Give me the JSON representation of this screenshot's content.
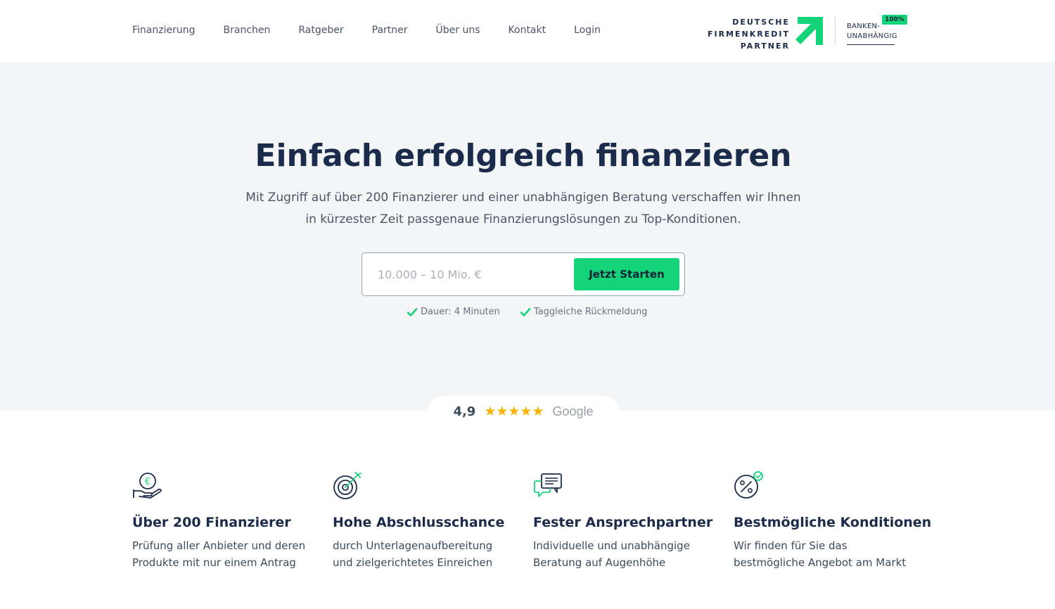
{
  "header": {
    "nav": [
      "Finanzierung",
      "Branchen",
      "Ratgeber",
      "Partner",
      "Über uns",
      "Kontakt",
      "Login"
    ],
    "logo": {
      "line1": "DEUTSCHE",
      "line2": "FIRMENKREDIT",
      "line3": "PARTNER",
      "badge": "100%",
      "banken_line1": "BANKEN-",
      "banken_line2": "UNABHÄNGIG"
    }
  },
  "hero": {
    "title": "Einfach erfolgreich finanzieren",
    "subtitle": "Mit Zugriff auf über 200 Finanzierer und einer unabhängigen Beratung verschaffen wir Ihnen in kürzester Zeit passgenaue Finanzierungslösungen zu Top-Konditionen.",
    "amount_placeholder": "10.000 – 10 Mio. €",
    "amount_value": "",
    "start_button": "Jetzt Starten",
    "checks": [
      "Dauer: 4 Minuten",
      "Taggleiche Rückmeldung"
    ]
  },
  "rating": {
    "score": "4,9",
    "stars": 5,
    "stars_text": "★★★★★",
    "source": "Google",
    "star_color": "#f5b400"
  },
  "features": [
    {
      "icon": "euro-hand-icon",
      "title": "Über 200 Finanzierer",
      "text": "Prüfung aller Anbieter und deren Produkte mit nur einem Antrag"
    },
    {
      "icon": "target-icon",
      "title": "Hohe Abschlusschance",
      "text": "durch Unterlagenaufbereitung und zielgerichtetes Einreichen"
    },
    {
      "icon": "chat-icon",
      "title": "Fester Ansprechpartner",
      "text": "Individuelle und unabhängige Beratung auf Augenhöhe"
    },
    {
      "icon": "percent-check-icon",
      "title": "Bestmögliche Konditionen",
      "text": "Wir finden für Sie das bestmögliche Angebot am Markt"
    }
  ],
  "colors": {
    "accent": "#14d47a",
    "navy": "#1b2b4b",
    "hero_bg": "#f3f5f6"
  }
}
